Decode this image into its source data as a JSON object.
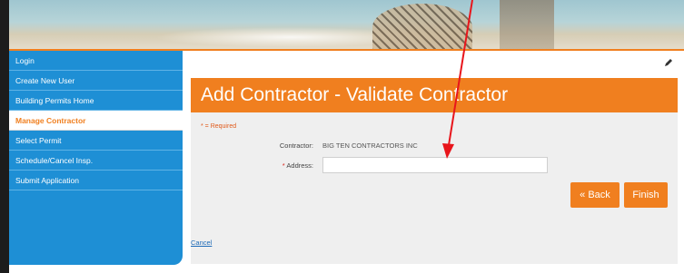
{
  "sidebar": {
    "items": [
      {
        "label": "Login"
      },
      {
        "label": "Create New User"
      },
      {
        "label": "Building Permits Home"
      },
      {
        "label": "Manage Contractor",
        "active": true
      },
      {
        "label": "Select Permit"
      },
      {
        "label": "Schedule/Cancel Insp."
      },
      {
        "label": "Submit Application"
      }
    ]
  },
  "main": {
    "title": "Add Contractor - Validate Contractor",
    "required_note": "* = Required",
    "contractor_label": "Contractor:",
    "contractor_value": "BIG TEN CONTRACTORS INC",
    "address_required_mark": "*",
    "address_label": "Address:",
    "address_value": "",
    "back_label": "« Back",
    "finish_label": "Finish",
    "cancel_label": "Cancel"
  },
  "colors": {
    "accent": "#f07f1f",
    "sidebar": "#1e8fd5",
    "annotation_arrow": "#e8151b"
  },
  "icons": {
    "edit": "pencil-icon"
  }
}
